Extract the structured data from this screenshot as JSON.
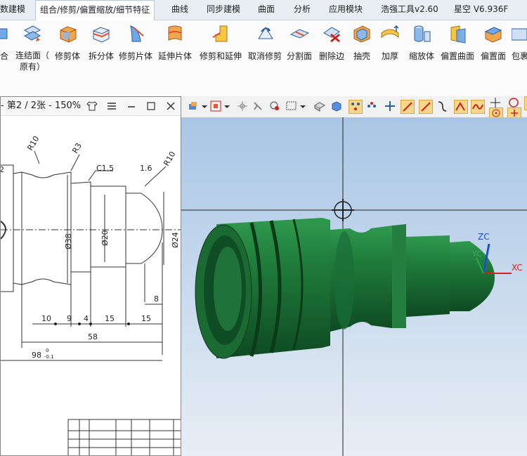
{
  "tabs": [
    {
      "label": "数建模"
    },
    {
      "label": "组合/修剪/偏置缩放/细节特征"
    },
    {
      "label": "曲线"
    },
    {
      "label": "同步建模"
    },
    {
      "label": "曲面"
    },
    {
      "label": "分析"
    },
    {
      "label": "应用模块"
    },
    {
      "label": "浩强工具v2.60"
    },
    {
      "label": "星空 V6.936F"
    }
  ],
  "ribbon": {
    "items": [
      {
        "label": "合",
        "icon": "combine-icon"
      },
      {
        "label": "连结面（原有）",
        "line1": "连结面（",
        "line2": "原有）",
        "icon": "join-face-icon"
      },
      {
        "label": "修剪体",
        "icon": "trim-body-icon"
      },
      {
        "label": "拆分体",
        "icon": "split-body-icon"
      },
      {
        "label": "修剪片体",
        "icon": "trim-sheet-icon"
      },
      {
        "label": "延伸片体",
        "icon": "extend-sheet-icon"
      },
      {
        "label": "修剪和延伸",
        "icon": "trim-extend-icon"
      },
      {
        "label": "取消修剪",
        "icon": "untrim-icon"
      },
      {
        "label": "分割面",
        "icon": "divide-face-icon"
      },
      {
        "label": "删除边",
        "icon": "delete-edge-icon"
      },
      {
        "label": "抽壳",
        "icon": "shell-icon"
      },
      {
        "label": "加厚",
        "icon": "thicken-icon"
      },
      {
        "label": "缩放体",
        "icon": "scale-body-icon"
      },
      {
        "label": "偏置曲面",
        "icon": "offset-surface-icon"
      },
      {
        "label": "偏置面",
        "icon": "offset-face-icon"
      },
      {
        "label": "包裹",
        "icon": "wrap-icon"
      }
    ]
  },
  "pdf": {
    "title": "- 第2 / 2张 - 150%",
    "drawing": {
      "dims": [
        "R10",
        "R3",
        "C1.5",
        "1.6",
        "R10",
        "Ø38",
        "Ø20",
        "Ø24",
        "8",
        "10",
        "9",
        "4",
        "15",
        "15",
        "58",
        "98",
        "0",
        "-0.1",
        "2"
      ]
    }
  },
  "axes": {
    "zc": "ZC",
    "yc": "YC",
    "xc": "XC"
  },
  "colors": {
    "accent": "#1e6fd9",
    "part": "#1f7a3a",
    "viewport_top": "#a9c6e6"
  }
}
